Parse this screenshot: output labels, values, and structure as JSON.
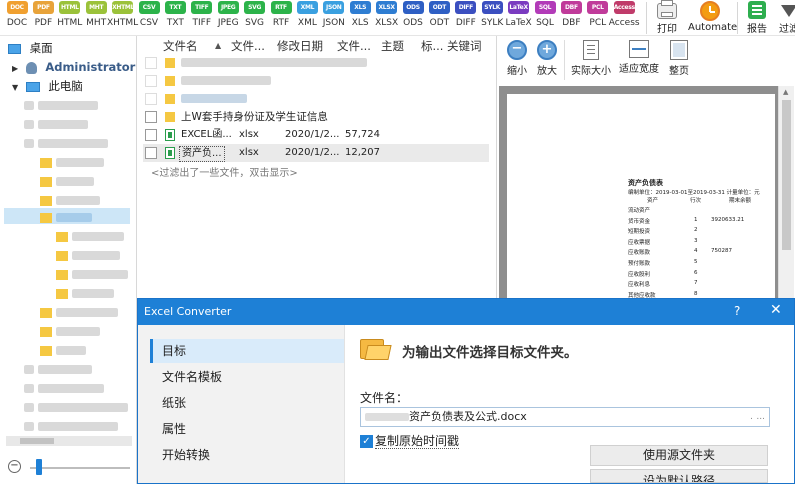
{
  "toolbar": {
    "formats": [
      {
        "label": "DOC",
        "color": "#f0a030"
      },
      {
        "label": "PDF",
        "color": "#e8a33a"
      },
      {
        "label": "HTML",
        "color": "#9bc23a"
      },
      {
        "label": "MHT",
        "color": "#9bc23a"
      },
      {
        "label": "XHTML",
        "color": "#9bc23a"
      },
      {
        "label": "CSV",
        "color": "#2cb34a"
      },
      {
        "label": "TXT",
        "color": "#2cb34a"
      },
      {
        "label": "TIFF",
        "color": "#2cb34a"
      },
      {
        "label": "JPEG",
        "color": "#2cb34a"
      },
      {
        "label": "SVG",
        "color": "#2cb34a"
      },
      {
        "label": "RTF",
        "color": "#2cb34a"
      },
      {
        "label": "XML",
        "color": "#3aa0e0"
      },
      {
        "label": "JSON",
        "color": "#3aa0e0"
      },
      {
        "label": "XLS",
        "color": "#2e7dd2"
      },
      {
        "label": "XLSX",
        "color": "#2e7dd2"
      },
      {
        "label": "ODS",
        "color": "#2e5fc4"
      },
      {
        "label": "ODT",
        "color": "#2e5fc4"
      },
      {
        "label": "DIFF",
        "color": "#3b4fc0"
      },
      {
        "label": "SYLK",
        "color": "#3b4fc0"
      },
      {
        "label": "LaTeX",
        "color": "#7a3bc0"
      },
      {
        "label": "SQL",
        "color": "#b23bb8"
      },
      {
        "label": "DBF",
        "color": "#c03b9a"
      },
      {
        "label": "PCL",
        "color": "#c03b9a"
      },
      {
        "label": "Access",
        "color": "#c03b6a"
      }
    ],
    "print_label": "打印",
    "automate_label": "Automate",
    "report_label": "报告",
    "filter_label": "过滤"
  },
  "tree": {
    "desktop": "桌面",
    "admin": "Administrator",
    "computer": "此电脑",
    "colors": {
      "folder": "#f5c842",
      "computer": "#4aa3e8"
    }
  },
  "filelist": {
    "columns": [
      "文件名",
      "文件...",
      "修改日期",
      "文件...",
      "主题",
      "标...",
      "关键词"
    ],
    "folder_row_label": "上W套手持身份证及学生证信息",
    "files": [
      {
        "name": "EXCEL函...",
        "ext": "xlsx",
        "date": "2020/1/2...",
        "size": "57,724"
      },
      {
        "name": "资产负...",
        "ext": "xlsx",
        "date": "2020/1/2...",
        "size": "12,207"
      }
    ],
    "hint": "<过滤出了一些文件，双击显示>"
  },
  "preview": {
    "tools": [
      "缩小",
      "放大",
      "实际大小",
      "适应宽度",
      "整页"
    ],
    "doc": {
      "title": "资产负债表",
      "period": "编制单位：2019-03-01至2019-03-31 计量单位：元",
      "header": [
        "资产",
        "行次",
        "期末余额"
      ],
      "rows": [
        {
          "label": "流动资产",
          "line": "",
          "value": ""
        },
        {
          "label": "货币资金",
          "line": "1",
          "value": "3920633.21"
        },
        {
          "label": "短期投资",
          "line": "2",
          "value": ""
        },
        {
          "label": "应收票据",
          "line": "3",
          "value": ""
        },
        {
          "label": "应收账款",
          "line": "4",
          "value": "750287"
        },
        {
          "label": "预付账款",
          "line": "5",
          "value": ""
        },
        {
          "label": "应收股利",
          "line": "6",
          "value": ""
        },
        {
          "label": "应收利息",
          "line": "7",
          "value": ""
        },
        {
          "label": "其他应收款",
          "line": "8",
          "value": ""
        }
      ]
    }
  },
  "dialog": {
    "title": "Excel Converter",
    "help": "?",
    "close": "✕",
    "nav": [
      "目标",
      "文件名模板",
      "纸张",
      "属性",
      "开始转换"
    ],
    "heading": "为输出文件选择目标文件夹。",
    "filename_label": "文件名：",
    "filename_value": "资产负债表及公式.docx",
    "checkbox_label": "复制原始时间戳",
    "checkbox_checked": true,
    "use_source_folder": "使用源文件夹",
    "set_default_path": "设为默认路径",
    "accent": "#1e80d6"
  }
}
